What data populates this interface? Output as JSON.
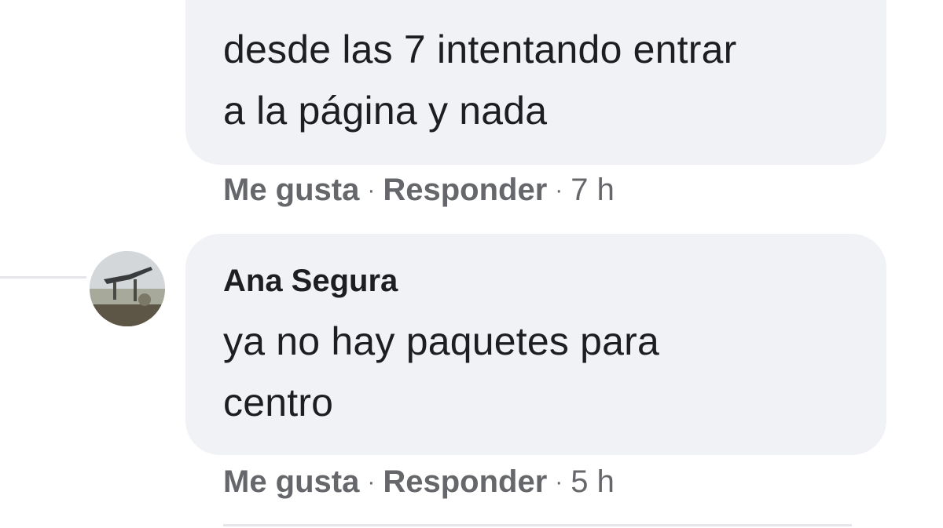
{
  "comments": [
    {
      "text_lines": [
        "desde las 7 intentando entrar",
        "a la página y nada"
      ],
      "actions": {
        "like": "Me gusta",
        "reply": "Responder",
        "separator": "·",
        "time": "7 h"
      }
    },
    {
      "author": "Ana Segura",
      "text_lines": [
        "ya no hay paquetes para",
        "centro"
      ],
      "actions": {
        "like": "Me gusta",
        "reply": "Responder",
        "separator": "·",
        "time": "5 h"
      }
    }
  ]
}
